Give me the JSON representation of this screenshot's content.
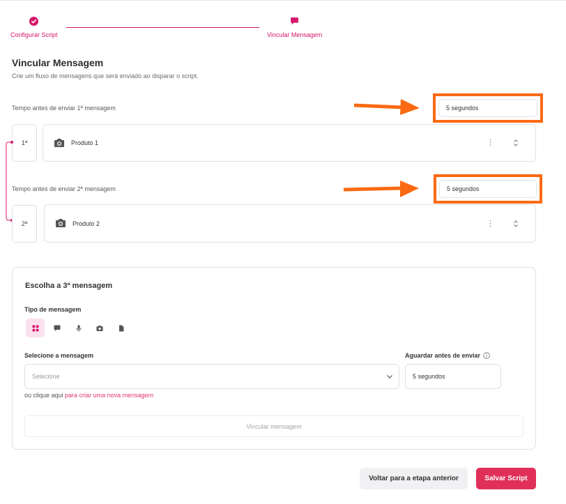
{
  "stepper": {
    "steps": [
      {
        "label": "Configurar Script",
        "state": "done"
      },
      {
        "label": "Vincular Mensagem",
        "state": "active"
      }
    ],
    "accent_color": "#d5166a"
  },
  "page": {
    "title": "Vincular Mensagem",
    "subtitle": "Crie um fluxo de mensagens que será enviado ao disparar o script."
  },
  "messages": [
    {
      "delay_label": "Tempo antes de enviar 1ª mensagem",
      "delay_value": "5 segundos",
      "number": "1ª",
      "icon": "camera-icon",
      "name": "Produto 1"
    },
    {
      "delay_label": "Tempo antes de enviar 2ª mensagem",
      "delay_value": "5 segundos",
      "number": "2ª",
      "icon": "camera-icon",
      "name": "Produto 2"
    }
  ],
  "annotation": {
    "color": "#fb6a12"
  },
  "composer": {
    "title": "Escolha a 3ª mensagem",
    "type_label": "Tipo de mensagem",
    "types": [
      "grid-icon",
      "chat-bubble-icon",
      "microphone-icon",
      "camera-icon",
      "document-icon"
    ],
    "select_label": "Selecione a mensagem",
    "select_placeholder": "Selecione",
    "wait_label": "Aguardar antes de enviar",
    "wait_value": "5 segundos",
    "create_prefix": "ou clique aqui ",
    "create_link": "para criar uma nova mensagem",
    "link_button": "Vincular mensagem"
  },
  "footer": {
    "back_label": "Voltar para a etapa anterior",
    "save_label": "Salvar Script",
    "save_color": "#e0305a"
  }
}
